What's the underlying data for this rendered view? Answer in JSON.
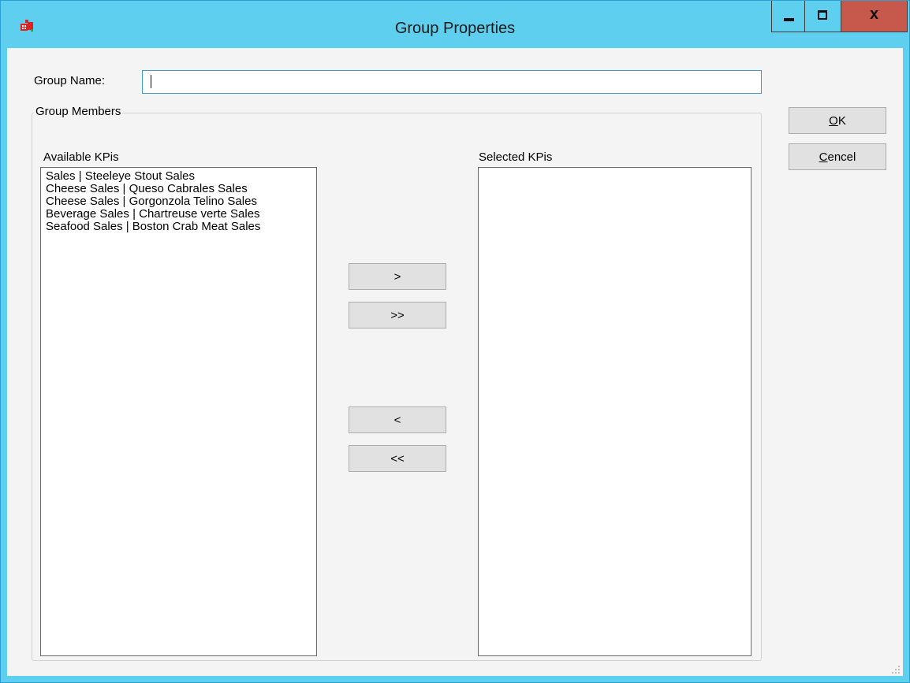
{
  "window": {
    "title": "Group Properties",
    "close_glyph": "x",
    "icons": [
      "app-icon",
      "minimize-icon",
      "maximize-icon",
      "close-icon"
    ]
  },
  "form": {
    "group_name_label": "Group Name:",
    "group_name_value": "",
    "group_members_legend": "Group Members",
    "available_label": "Available KPis",
    "selected_label": "Selected KPis",
    "available_items": [
      "Sales | Steeleye Stout Sales",
      "Cheese Sales | Queso Cabrales Sales",
      "Cheese Sales | Gorgonzola Telino Sales",
      "Beverage Sales | Chartreuse verte Sales",
      "Seafood Sales | Boston Crab Meat Sales"
    ],
    "selected_items": []
  },
  "buttons": {
    "add_one": ">",
    "add_all": ">>",
    "remove_one": "<",
    "remove_all": "<<",
    "ok_accel": "O",
    "ok_rest": "K",
    "cancel_accel": "C",
    "cancel_rest": "encel"
  },
  "colors": {
    "titlebar": "#5ecfee",
    "close_button": "#c7584c",
    "client_background": "#f4f4f4",
    "input_focus_border": "#3c9bd4"
  }
}
